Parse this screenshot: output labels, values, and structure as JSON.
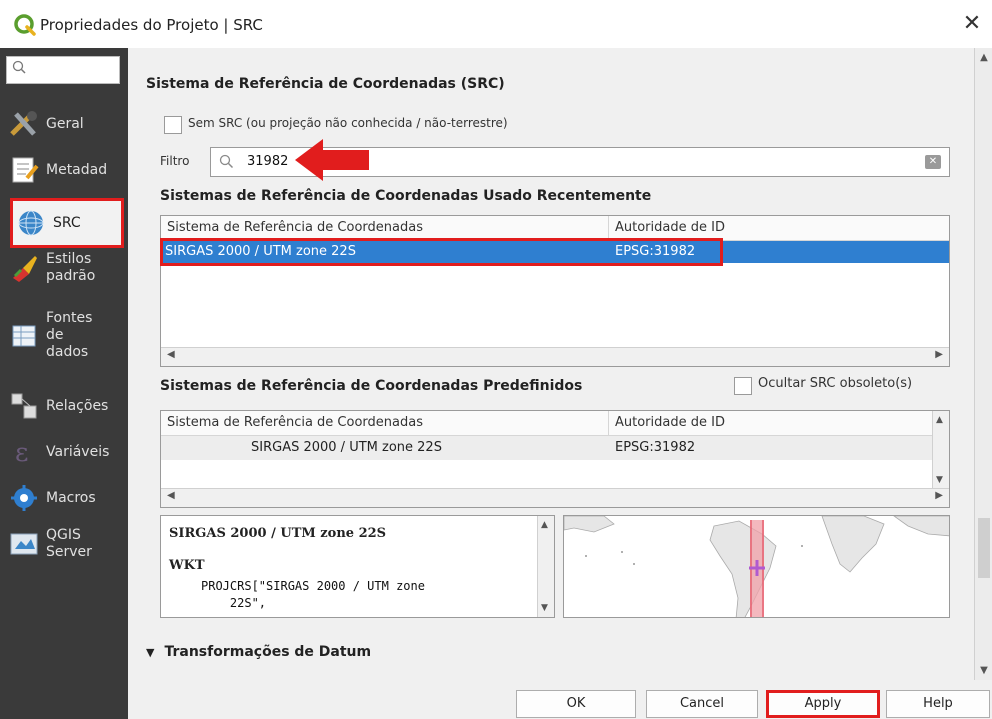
{
  "window": {
    "title": "Propriedades do Projeto | SRC",
    "close_icon": "close-icon"
  },
  "sidebar": {
    "search_icon": "search-icon",
    "items": [
      {
        "label": "Geral",
        "icon": "tools-icon"
      },
      {
        "label": "Metadad",
        "icon": "metadata-icon"
      },
      {
        "label": "SRC",
        "icon": "globe-icon"
      },
      {
        "label": "Estilos\npadrão",
        "icon": "styles-icon"
      },
      {
        "label": "Fontes\nde\ndados",
        "icon": "data-sources-icon"
      },
      {
        "label": "Relações",
        "icon": "relations-icon"
      },
      {
        "label": "Variáveis",
        "icon": "variables-icon"
      },
      {
        "label": "Macros",
        "icon": "macros-icon"
      },
      {
        "label": "QGIS\nServer",
        "icon": "server-icon"
      }
    ]
  },
  "main": {
    "section_title": "Sistema de Referência de Coordenadas (SRC)",
    "no_crs_label": "Sem SRC (ou projeção não conhecida / não-terrestre)",
    "filter_label": "Filtro",
    "filter_value": "31982",
    "recent": {
      "title": "Sistemas de Referência de Coordenadas Usado Recentemente",
      "columns": [
        "Sistema de Referência de Coordenadas",
        "Autoridade de ID"
      ],
      "rows": [
        {
          "name": "SIRGAS 2000 / UTM zone 22S",
          "authority": "EPSG:31982",
          "selected": true
        }
      ]
    },
    "predefined": {
      "title": "Sistemas de Referência de Coordenadas Predefinidos",
      "hide_deprecated_label": "Ocultar SRC obsoleto(s)",
      "columns": [
        "Sistema de Referência de Coordenadas",
        "Autoridade de ID"
      ],
      "rows": [
        {
          "name": "SIRGAS 2000 / UTM zone 22S",
          "authority": "EPSG:31982"
        }
      ]
    },
    "wkt": {
      "crs_name": "SIRGAS 2000 / UTM zone 22S",
      "heading": "WKT",
      "body": "PROJCRS[\"SIRGAS 2000 / UTM zone\n    22S\","
    },
    "datum_transformations": "Transformações de Datum"
  },
  "buttons": {
    "ok": "OK",
    "cancel": "Cancel",
    "apply": "Apply",
    "help": "Help"
  },
  "colors": {
    "highlight": "#e11d1d",
    "selection": "#2f7fd0",
    "sidebar_bg": "#3a3a3a"
  }
}
